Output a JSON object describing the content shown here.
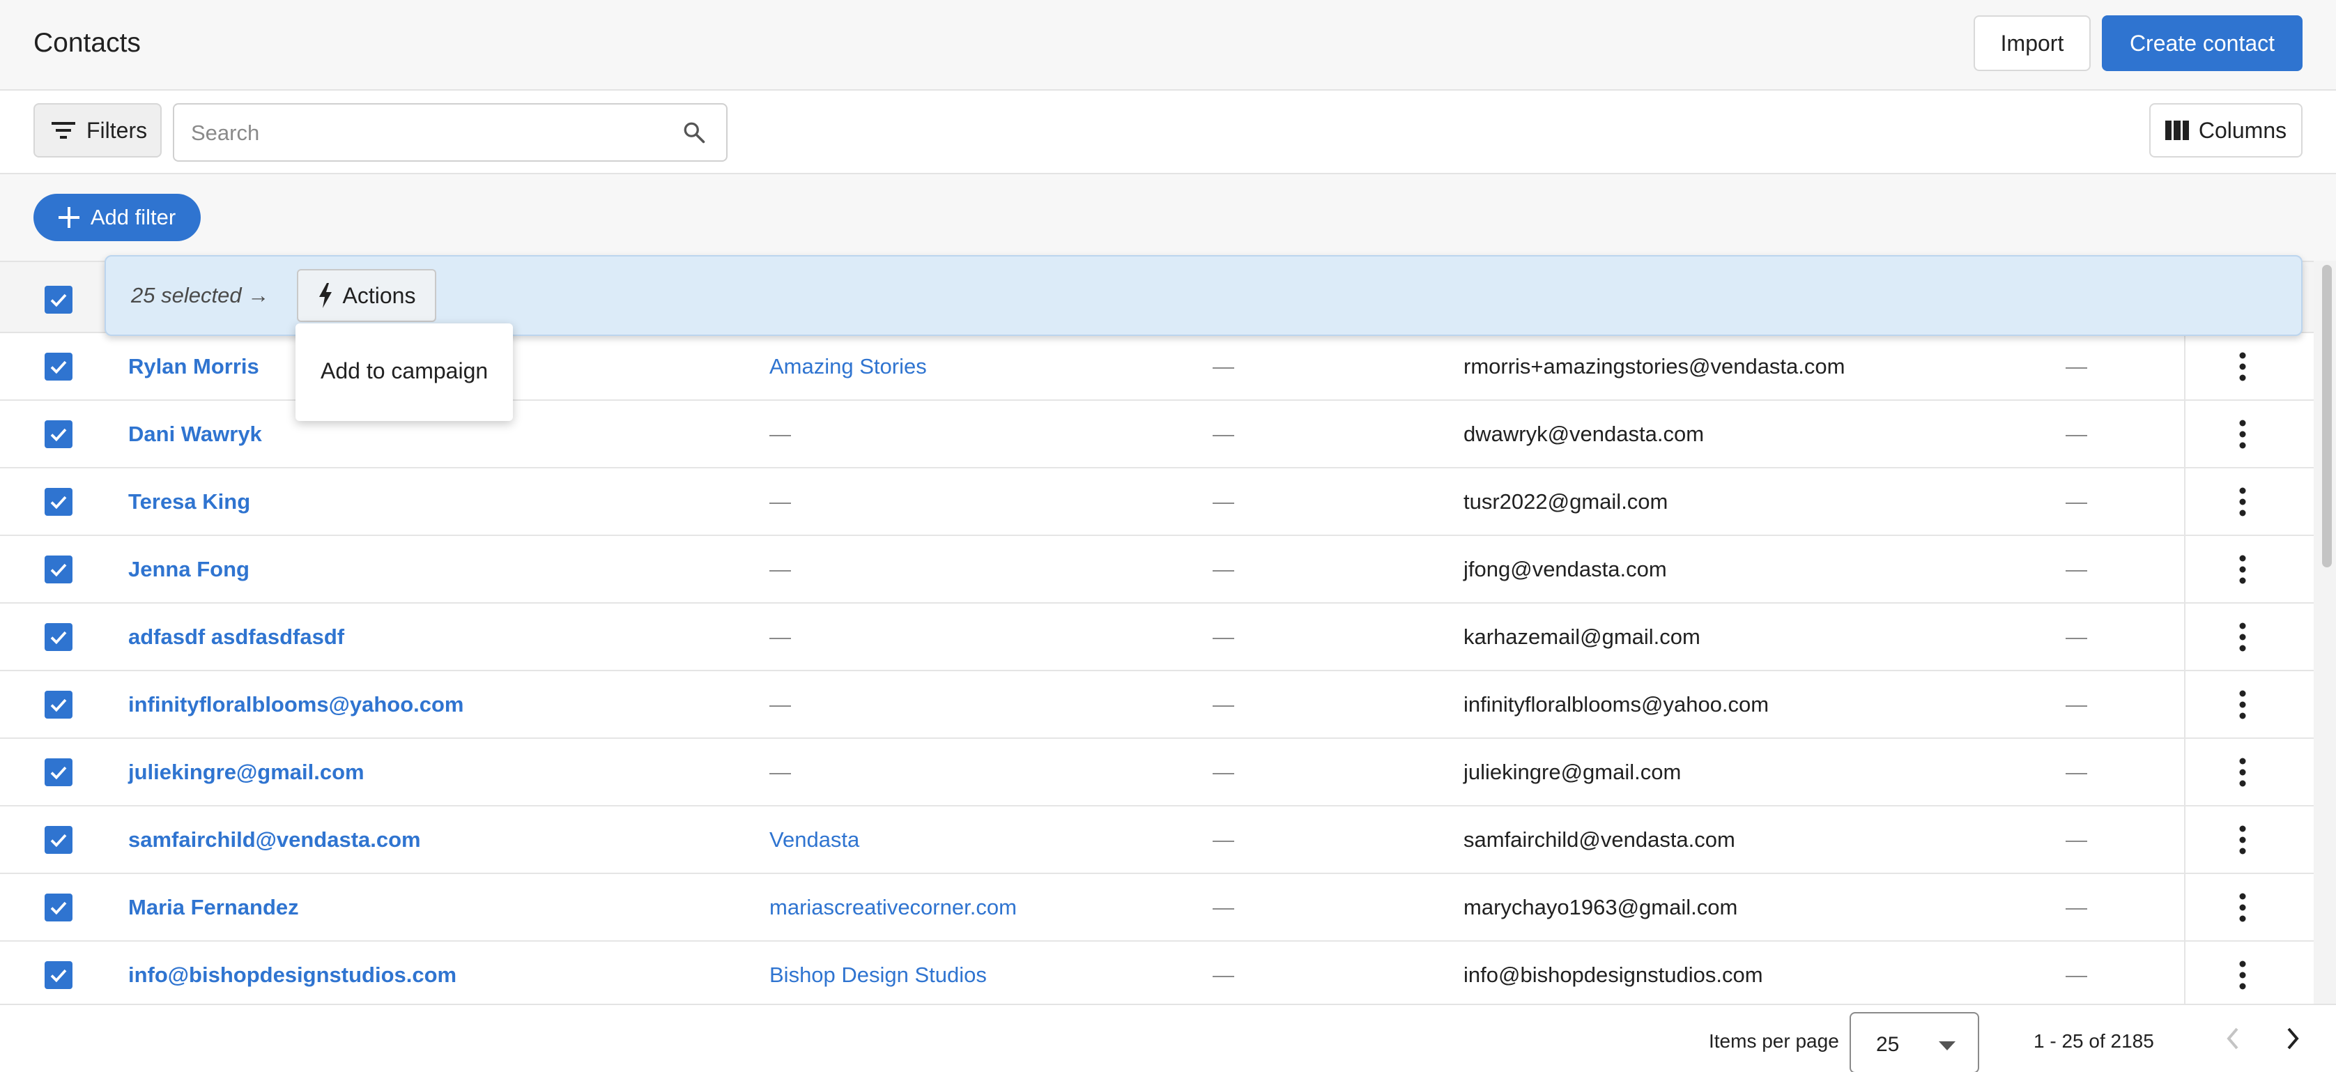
{
  "header": {
    "title": "Contacts",
    "import_label": "Import",
    "create_label": "Create contact"
  },
  "toolbar": {
    "filters_label": "Filters",
    "search_placeholder": "Search",
    "columns_label": "Columns"
  },
  "filter_bar": {
    "add_filter_label": "Add filter"
  },
  "selection": {
    "text": "25 selected →",
    "actions_label": "Actions",
    "menu_items": [
      "Add to campaign"
    ]
  },
  "rows": [
    {
      "name": "Rylan Morris",
      "company": "Amazing Stories",
      "phone": "—",
      "email": "rmorris+amazingstories@vendasta.com",
      "extra": "—"
    },
    {
      "name": "Dani Wawryk",
      "company": "—",
      "phone": "—",
      "email": "dwawryk@vendasta.com",
      "extra": "—"
    },
    {
      "name": "Teresa King",
      "company": "—",
      "phone": "—",
      "email": "tusr2022@gmail.com",
      "extra": "—"
    },
    {
      "name": "Jenna Fong",
      "company": "—",
      "phone": "—",
      "email": "jfong@vendasta.com",
      "extra": "—"
    },
    {
      "name": "adfasdf asdfasdfasdf",
      "company": "—",
      "phone": "—",
      "email": "karhazemail@gmail.com",
      "extra": "—"
    },
    {
      "name": "infinityfloralblooms@yahoo.com",
      "company": "—",
      "phone": "—",
      "email": "infinityfloralblooms@yahoo.com",
      "extra": "—"
    },
    {
      "name": "juliekingre@gmail.com",
      "company": "—",
      "phone": "—",
      "email": "juliekingre@gmail.com",
      "extra": "—"
    },
    {
      "name": "samfairchild@vendasta.com",
      "company": "Vendasta",
      "phone": "—",
      "email": "samfairchild@vendasta.com",
      "extra": "—"
    },
    {
      "name": "Maria Fernandez",
      "company": "mariascreativecorner.com",
      "phone": "—",
      "email": "marychayo1963@gmail.com",
      "extra": "—"
    },
    {
      "name": "info@bishopdesignstudios.com",
      "company": "Bishop Design Studios",
      "phone": "—",
      "email": "info@bishopdesignstudios.com",
      "extra": "—"
    }
  ],
  "footer": {
    "items_per_page_label": "Items per page",
    "items_per_page_value": "25",
    "range_text": "1 - 25 of 2185"
  },
  "colors": {
    "accent": "#2f74d0",
    "selection_banner": "#dcebf8"
  }
}
